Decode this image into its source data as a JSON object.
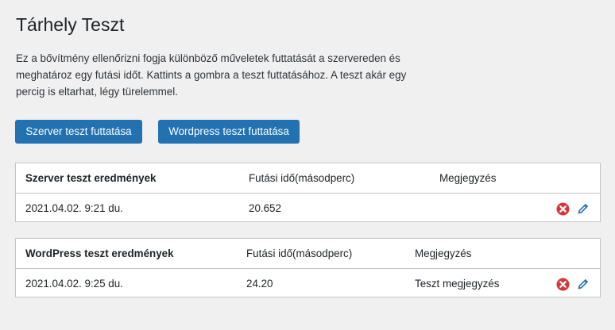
{
  "page": {
    "title": "Tárhely Teszt",
    "intro": "Ez a bővítmény ellenőrizni fogja különböző műveletek futtatását a szervereden és meghatároz egy futási időt. Kattints a gombra a teszt futtatásához. A teszt akár egy percig is eltarhat, légy türelemmel."
  },
  "buttons": {
    "server_test": "Szerver teszt futtatása",
    "wp_test": "Wordpress teszt futtatása"
  },
  "colors": {
    "primary": "#2271b1",
    "delete_icon": "#d63638",
    "edit_icon": "#2271b1"
  },
  "server_table": {
    "headers": [
      "Szerver teszt eredmények",
      "Futási idő(másodperc)",
      "Megjegyzés"
    ],
    "rows": [
      {
        "date": "2021.04.02. 9:21 du.",
        "runtime": "20.652",
        "note": ""
      }
    ]
  },
  "wp_table": {
    "headers": [
      "WordPress teszt eredmények",
      "Futási idő(másodperc)",
      "Megjegyzés"
    ],
    "rows": [
      {
        "date": "2021.04.02. 9:25 du.",
        "runtime": "24.20",
        "note": "Teszt megjegyzés"
      }
    ]
  },
  "icons": {
    "delete": "delete-icon",
    "edit": "edit-icon"
  }
}
